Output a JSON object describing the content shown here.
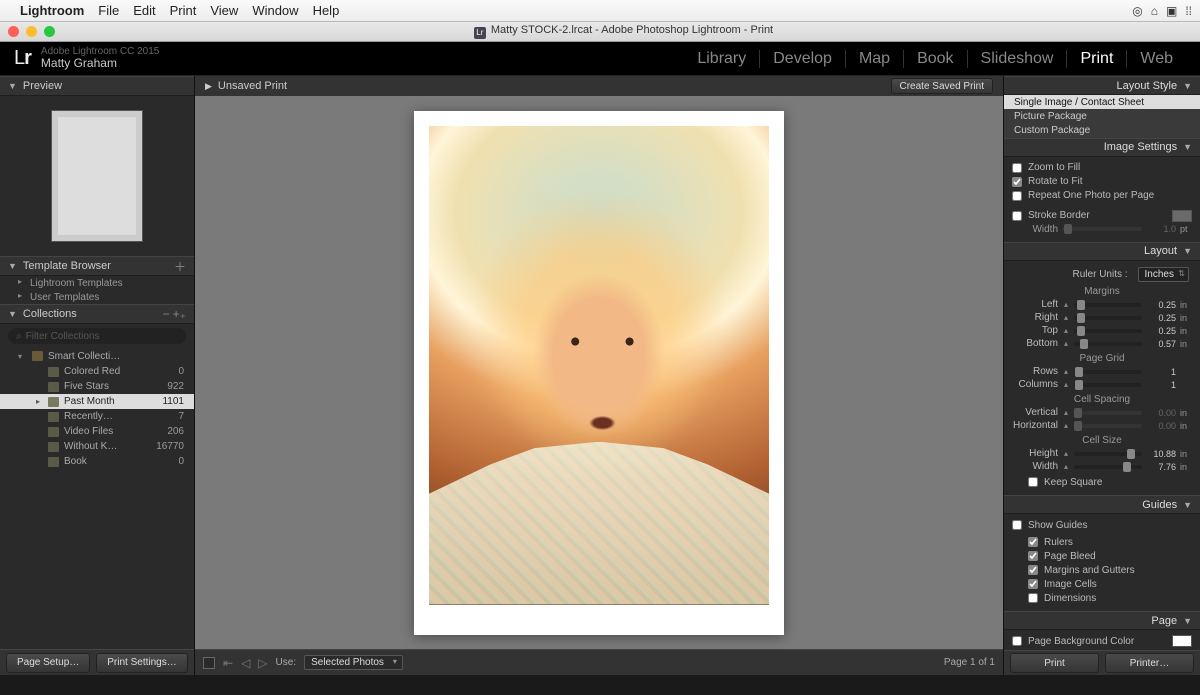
{
  "mac_menu": {
    "app": "Lightroom",
    "items": [
      "File",
      "Edit",
      "Print",
      "View",
      "Window",
      "Help"
    ]
  },
  "window_title": "Matty STOCK-2.lrcat - Adobe Photoshop Lightroom - Print",
  "header": {
    "product_line": "Adobe Lightroom CC 2015",
    "user": "Matty Graham"
  },
  "modules": [
    "Library",
    "Develop",
    "Map",
    "Book",
    "Slideshow",
    "Print",
    "Web"
  ],
  "active_module": "Print",
  "left": {
    "preview_title": "Preview",
    "template_title": "Template Browser",
    "template_items": [
      "Lightroom Templates",
      "User Templates"
    ],
    "collections_title": "Collections",
    "filter_placeholder": "Filter Collections",
    "smart_label": "Smart Collecti…",
    "rows": [
      {
        "name": "Colored Red",
        "count": "0"
      },
      {
        "name": "Five Stars",
        "count": "922"
      },
      {
        "name": "Past Month",
        "count": "1101",
        "selected": true
      },
      {
        "name": "Recently…",
        "count": "7"
      },
      {
        "name": "Video Files",
        "count": "206"
      },
      {
        "name": "Without K…",
        "count": "16770"
      },
      {
        "name": "Book",
        "count": "0"
      }
    ],
    "footer": {
      "page_setup": "Page Setup…",
      "print_settings": "Print Settings…"
    }
  },
  "center": {
    "doc_title": "Unsaved Print",
    "create_saved": "Create Saved Print",
    "use_label": "Use:",
    "use_value": "Selected Photos",
    "page_info": "Page 1 of 1"
  },
  "right": {
    "layout_style": {
      "title": "Layout Style",
      "items": [
        "Single Image / Contact Sheet",
        "Picture Package",
        "Custom Package"
      ],
      "selected": 0
    },
    "image_settings": {
      "title": "Image Settings",
      "zoom": "Zoom to Fill",
      "rotate": "Rotate to Fit",
      "repeat": "Repeat One Photo per Page",
      "stroke": "Stroke Border",
      "width_label": "Width",
      "width_value": "1.0",
      "width_unit": "pt"
    },
    "layout": {
      "title": "Layout",
      "ruler_label": "Ruler Units :",
      "ruler_value": "Inches",
      "margins_label": "Margins",
      "margins": [
        {
          "label": "Left",
          "val": "0.25",
          "unit": "in",
          "pos": 5
        },
        {
          "label": "Right",
          "val": "0.25",
          "unit": "in",
          "pos": 5
        },
        {
          "label": "Top",
          "val": "0.25",
          "unit": "in",
          "pos": 5
        },
        {
          "label": "Bottom",
          "val": "0.57",
          "unit": "in",
          "pos": 9
        }
      ],
      "pagegrid_label": "Page Grid",
      "pagegrid": [
        {
          "label": "Rows",
          "val": "1",
          "unit": "",
          "pos": 2
        },
        {
          "label": "Columns",
          "val": "1",
          "unit": "",
          "pos": 2
        }
      ],
      "cellspacing_label": "Cell Spacing",
      "cellspacing": [
        {
          "label": "Vertical",
          "val": "0.00",
          "unit": "in",
          "dis": true
        },
        {
          "label": "Horizontal",
          "val": "0.00",
          "unit": "in",
          "dis": true
        }
      ],
      "cellsize_label": "Cell Size",
      "cellsize": [
        {
          "label": "Height",
          "val": "10.88",
          "unit": "in",
          "pos": 78
        },
        {
          "label": "Width",
          "val": "7.76",
          "unit": "in",
          "pos": 72
        }
      ],
      "keep_square": "Keep Square"
    },
    "guides": {
      "title": "Guides",
      "show": "Show Guides",
      "items": [
        "Rulers",
        "Page Bleed",
        "Margins and Gutters",
        "Image Cells",
        "Dimensions"
      ],
      "checked": [
        true,
        true,
        true,
        true,
        false
      ]
    },
    "page": {
      "title": "Page",
      "bg": "Page Background Color"
    },
    "footer": {
      "print": "Print",
      "printer": "Printer…"
    }
  }
}
